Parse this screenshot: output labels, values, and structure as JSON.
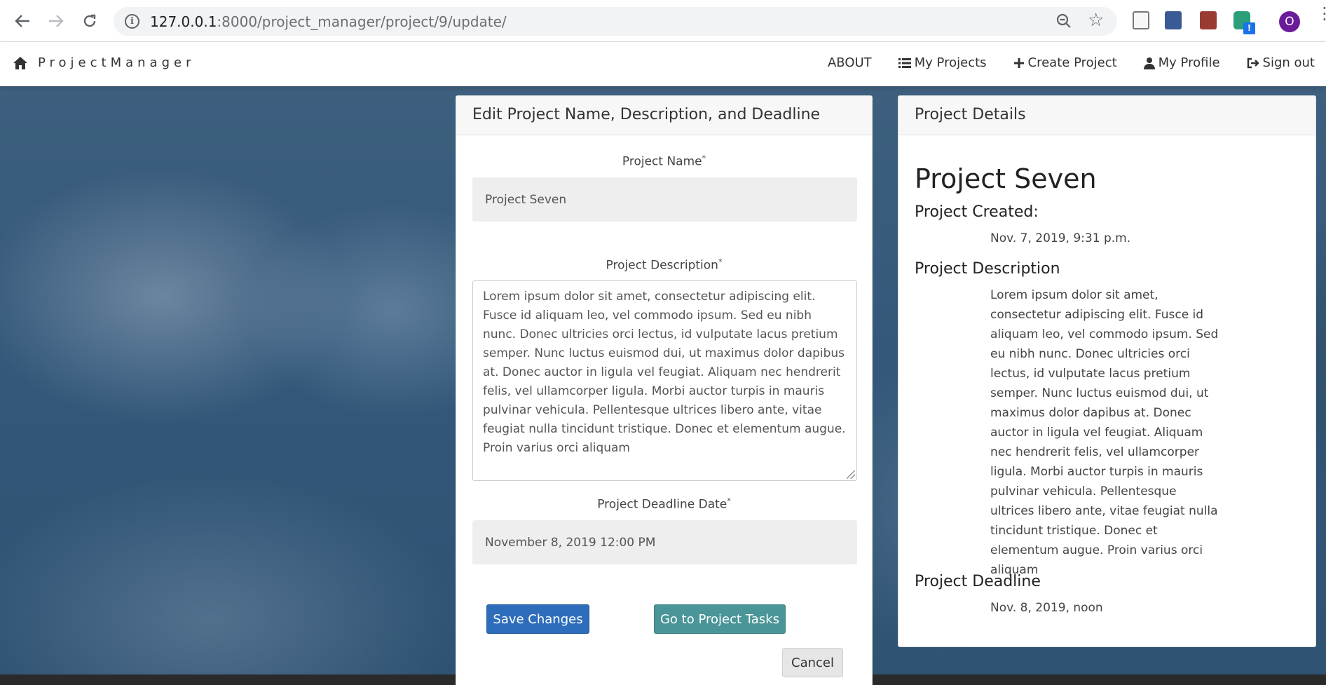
{
  "browser": {
    "url_host": "127.0.0.1",
    "url_path": ":8000/project_manager/project/9/update/",
    "profile_initial": "O",
    "extension_badge": "!"
  },
  "navbar": {
    "brand": "ProjectManager",
    "links": [
      "ABOUT",
      "My Projects",
      "Create Project",
      "My Profile",
      "Sign out"
    ]
  },
  "edit_form": {
    "header": "Edit Project Name, Description, and Deadline",
    "name_label": "Project Name",
    "name_value": "Project Seven",
    "description_label": "Project Description",
    "description_value": "Lorem ipsum dolor sit amet, consectetur adipiscing elit. Fusce id aliquam leo, vel commodo ipsum. Sed eu nibh nunc. Donec ultricies orci lectus, id vulputate lacus pretium semper. Nunc luctus euismod dui, ut maximus dolor dapibus at. Donec auctor in ligula vel feugiat. Aliquam nec hendrerit felis, vel ullamcorper ligula. Morbi auctor turpis in mauris pulvinar vehicula. Pellentesque ultrices libero ante, vitae feugiat nulla tincidunt tristique. Donec et elementum augue. Proin varius orci aliquam",
    "deadline_label": "Project Deadline Date",
    "deadline_value": "November 8, 2019 12:00 PM",
    "required_mark": "*",
    "save_label": "Save Changes",
    "tasks_label": "Go to Project Tasks",
    "cancel_label": "Cancel"
  },
  "details": {
    "header": "Project Details",
    "title": "Project Seven",
    "created_heading": "Project Created:",
    "created_value": "Nov. 7, 2019, 9:31 p.m.",
    "description_heading": "Project Description",
    "description_value": "Lorem ipsum dolor sit amet, consectetur adipiscing elit. Fusce id aliquam leo, vel commodo ipsum. Sed eu nibh nunc. Donec ultricies orci lectus, id vulputate lacus pretium semper. Nunc luctus euismod dui, ut maximus dolor dapibus at. Donec auctor in ligula vel feugiat. Aliquam nec hendrerit felis, vel ullamcorper ligula. Morbi auctor turpis in mauris pulvinar vehicula. Pellentesque ultrices libero ante, vitae feugiat nulla tincidunt tristique. Donec et elementum augue. Proin varius orci aliquam",
    "deadline_heading": "Project Deadline",
    "deadline_value": "Nov. 8, 2019, noon"
  },
  "colors": {
    "save_button": "#2e6dbb",
    "tasks_button": "#4a9597",
    "cancel_button": "#e6e6e6",
    "background": "#34587a"
  },
  "icons": [
    "back-icon",
    "forward-icon",
    "reload-icon",
    "info-icon",
    "zoom-out-icon",
    "star-icon",
    "home-icon",
    "list-icon",
    "plus-icon",
    "user-icon",
    "sign-out-icon"
  ]
}
